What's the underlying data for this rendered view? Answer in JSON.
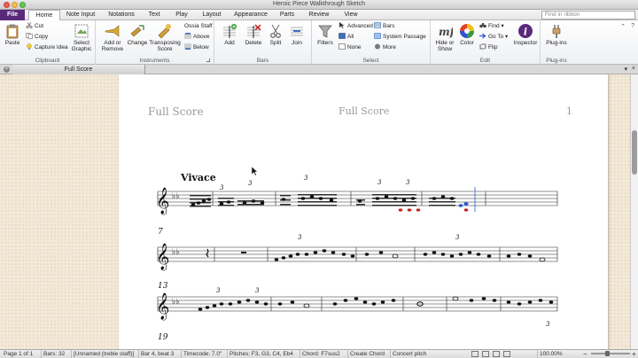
{
  "window": {
    "title": "Heroic Piece Walkthrough Sketch"
  },
  "tabs": {
    "file": "File",
    "items": [
      "Home",
      "Note Input",
      "Notations",
      "Text",
      "Play",
      "Layout",
      "Appearance",
      "Parts",
      "Review",
      "View"
    ],
    "active": "Home"
  },
  "search": {
    "placeholder": "Find in ribbon"
  },
  "ribbon": {
    "clipboard": {
      "label": "Clipboard",
      "paste": "Paste",
      "cut": "Cut",
      "copy": "Copy",
      "capture_idea": "Capture Idea",
      "select_graphic": "Select Graphic"
    },
    "instruments": {
      "label": "Instruments",
      "add_remove": "Add or Remove",
      "change": "Change",
      "transposing_score": "Transposing Score",
      "ossia_staff": "Ossia Staff",
      "above": "Above",
      "below": "Below"
    },
    "bars": {
      "label": "Bars",
      "add": "Add",
      "delete": "Delete",
      "split": "Split",
      "join": "Join"
    },
    "select": {
      "label": "Select",
      "filters": "Filters",
      "advanced": "Advanced",
      "all": "All",
      "none": "None",
      "bars": "Bars",
      "system_passage": "System Passage",
      "more": "More"
    },
    "edit": {
      "label": "Edit",
      "hide_show": "Hide or Show",
      "color": "Color",
      "find": "Find",
      "go_to": "Go To",
      "flip": "Flip",
      "inspector": "Inspector"
    },
    "plugins": {
      "label": "Plug-ins",
      "plugins": "Plug-ins"
    }
  },
  "document_tab": {
    "label": "Full Score"
  },
  "score": {
    "header_left": "Full Score",
    "header_center": "Full Score",
    "page_number": "1",
    "tempo": "Vivace",
    "bar_numbers": [
      "7",
      "13",
      "19"
    ]
  },
  "status": {
    "page": "Page 1 of 1",
    "bars": "Bars: 32",
    "staff": "[Unnamed (treble staff)]",
    "position": "Bar 4, beat 3",
    "timecode": "Timecode: 7.0\"",
    "pitches": "Pitches: F3, G3, C4, Eb4",
    "chord": "Chord: F7sus2",
    "create_chord": "Create Chord",
    "concert_pitch": "Concert pitch",
    "zoom": "100.00%"
  },
  "colors": {
    "file_tab": "#5a2a7a",
    "selection_blue": "#2a56d6",
    "selection_red": "#c8201b",
    "paper": "#f3e9d8"
  }
}
